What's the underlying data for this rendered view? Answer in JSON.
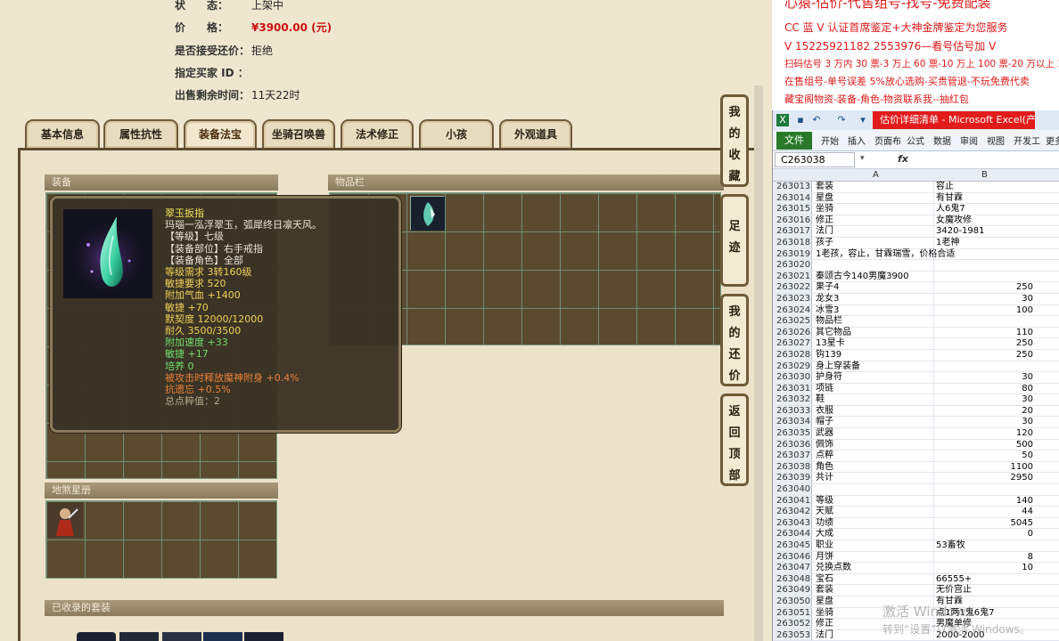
{
  "listing": {
    "status_label": "状　　态：",
    "status_value": "上架中",
    "price_label": "价　　格：",
    "price_value": "¥3900.00 (元)",
    "bargain_label": "是否接受还价：",
    "bargain_value": "拒绝",
    "buyer_label": "指定买家 ID ：",
    "buyer_value": "",
    "time_label": "出售剩余时间：",
    "time_value": "11天22时"
  },
  "tabs": [
    {
      "label": "基本信息"
    },
    {
      "label": "属性抗性"
    },
    {
      "label": "装备法宝"
    },
    {
      "label": "坐骑召唤兽"
    },
    {
      "label": "法术修正"
    },
    {
      "label": "小孩"
    },
    {
      "label": "外观道具"
    }
  ],
  "active_tab": "装备法宝",
  "sections": {
    "equipment": "装备",
    "inventory": "物品栏",
    "earth_book": "地煞星册",
    "suits": "已收录的套装"
  },
  "tooltip": {
    "title": "翠玉扳指",
    "desc": "玛瑙一泓浮翠玉，弧犀终日凛天风。",
    "lines": [
      {
        "text": "【等级】七级",
        "color": "white"
      },
      {
        "text": "【装备部位】右手戒指",
        "color": "white"
      },
      {
        "text": "【装备角色】全部",
        "color": "white"
      },
      {
        "text": "等级需求 3转160级",
        "color": "yellow"
      },
      {
        "text": "敏捷要求 520",
        "color": "yellow"
      },
      {
        "text": "附加气血 +1400",
        "color": "yellow"
      },
      {
        "text": "敏捷 +70",
        "color": "yellow"
      },
      {
        "text": "默契度 12000/12000",
        "color": "yellow"
      },
      {
        "text": "耐久 3500/3500",
        "color": "yellow"
      },
      {
        "text": "附加速度 +33",
        "color": "green"
      },
      {
        "text": "敏捷 +17",
        "color": "green"
      },
      {
        "text": "培养 0",
        "color": "green"
      },
      {
        "text": "被攻击时释放魔神附身 +0.4%",
        "color": "orange"
      },
      {
        "text": "抗遗忘 +0.5%",
        "color": "orange"
      },
      {
        "text": "总点粹值：2",
        "color": "gray"
      }
    ]
  },
  "side_buttons": [
    {
      "label": "我的收藏",
      "chars": [
        "我",
        "的",
        "收",
        "藏"
      ]
    },
    {
      "label": "足迹",
      "chars": [
        "足",
        "迹"
      ]
    },
    {
      "label": "我的还价",
      "chars": [
        "我",
        "的",
        "还",
        "价"
      ]
    },
    {
      "label": "返回顶部",
      "chars": [
        "返",
        "回",
        "顶",
        "部"
      ]
    }
  ],
  "overlay": [
    "心猿-估价-代售组号-找号-免费配装",
    "CC 蓝 V 认证首席鉴定+大神金牌鉴定为您服务",
    "V 15225921182    2553976—看号估号加 V",
    "扫码估号 3 万内 30 票-3 万上 60 票-10 万上 100 票-20 万以上 150",
    "在售组号-单号误差 5%放心选购-买贵管退-不玩免费代卖",
    "藏宝阁物资-装备-角色-物资联系我--抽红包"
  ],
  "excel": {
    "title": "估价详细清单 - Microsoft Excel(产品...",
    "file_tab": "文件",
    "ribbon_tabs": [
      "开始",
      "插入",
      "页面布",
      "公式",
      "数据",
      "审阅",
      "视图",
      "开发工",
      "更多"
    ],
    "name_box": "C263038",
    "fx": "fx",
    "col_headers": [
      "A",
      "B"
    ],
    "rows": [
      {
        "n": "263013",
        "a": "套装",
        "b": "容止",
        "num": false
      },
      {
        "n": "263014",
        "a": "星盘",
        "b": "有甘霖",
        "num": false
      },
      {
        "n": "263015",
        "a": "坐骑",
        "b": "人6鬼7",
        "num": false
      },
      {
        "n": "263016",
        "a": "修正",
        "b": "女魔攻修",
        "num": false
      },
      {
        "n": "263017",
        "a": "法门",
        "b": "3420-1981",
        "num": false
      },
      {
        "n": "263018",
        "a": "孩子",
        "b": "1老神",
        "num": false
      },
      {
        "n": "263019",
        "a": "1老孩，容止，甘霖瑞雪，价格合适",
        "b": "",
        "num": false
      },
      {
        "n": "263020",
        "a": "",
        "b": "",
        "num": false
      },
      {
        "n": "263021",
        "a": "秦颂古今140男魔3900",
        "b": "",
        "num": false
      },
      {
        "n": "263022",
        "a": "果子4",
        "b": "250",
        "num": true
      },
      {
        "n": "263023",
        "a": "龙女3",
        "b": "30",
        "num": true
      },
      {
        "n": "263024",
        "a": "冰雪3",
        "b": "100",
        "num": true
      },
      {
        "n": "263025",
        "a": "物品栏",
        "b": "",
        "num": false
      },
      {
        "n": "263026",
        "a": "其它物品",
        "b": "110",
        "num": true
      },
      {
        "n": "263027",
        "a": "13星卡",
        "b": "250",
        "num": true
      },
      {
        "n": "263028",
        "a": "钩139",
        "b": "250",
        "num": true
      },
      {
        "n": "263029",
        "a": "身上穿装备",
        "b": "",
        "num": false
      },
      {
        "n": "263030",
        "a": "护身符",
        "b": "30",
        "num": true
      },
      {
        "n": "263031",
        "a": "项链",
        "b": "80",
        "num": true
      },
      {
        "n": "263032",
        "a": "鞋",
        "b": "30",
        "num": true
      },
      {
        "n": "263033",
        "a": "衣服",
        "b": "20",
        "num": true
      },
      {
        "n": "263034",
        "a": "帽子",
        "b": "30",
        "num": true
      },
      {
        "n": "263035",
        "a": "武器",
        "b": "120",
        "num": true
      },
      {
        "n": "263036",
        "a": "佩饰",
        "b": "500",
        "num": true
      },
      {
        "n": "263037",
        "a": "点粹",
        "b": "50",
        "num": true
      },
      {
        "n": "263038",
        "a": "角色",
        "b": "1100",
        "num": true
      },
      {
        "n": "263039",
        "a": "共计",
        "b": "2950",
        "num": true
      },
      {
        "n": "263040",
        "a": "",
        "b": "",
        "num": false
      },
      {
        "n": "263041",
        "a": "等级",
        "b": "140",
        "num": true
      },
      {
        "n": "263042",
        "a": "天赋",
        "b": "44",
        "num": true
      },
      {
        "n": "263043",
        "a": "功绩",
        "b": "5045",
        "num": true
      },
      {
        "n": "263044",
        "a": "大成",
        "b": "0",
        "num": true
      },
      {
        "n": "263045",
        "a": "职业",
        "b": "53畜牧",
        "num": false
      },
      {
        "n": "263046",
        "a": "月饼",
        "b": "8",
        "num": true
      },
      {
        "n": "263047",
        "a": "兑换点数",
        "b": "10",
        "num": true
      },
      {
        "n": "263048",
        "a": "宝石",
        "b": "66555+",
        "num": false
      },
      {
        "n": "263049",
        "a": "套装",
        "b": "无价宫止",
        "num": false
      },
      {
        "n": "263050",
        "a": "星盘",
        "b": "有甘霖",
        "num": false
      },
      {
        "n": "263051",
        "a": "坐骑",
        "b": "点1两1鬼6鬼7",
        "num": false
      },
      {
        "n": "263052",
        "a": "修正",
        "b": "男魔单修",
        "num": false
      },
      {
        "n": "263053",
        "a": "法门",
        "b": "2000-2000",
        "num": false
      }
    ]
  },
  "watermark": {
    "line1": "激活 Windows",
    "line2": "转到“设置”以激活 Windows。"
  }
}
